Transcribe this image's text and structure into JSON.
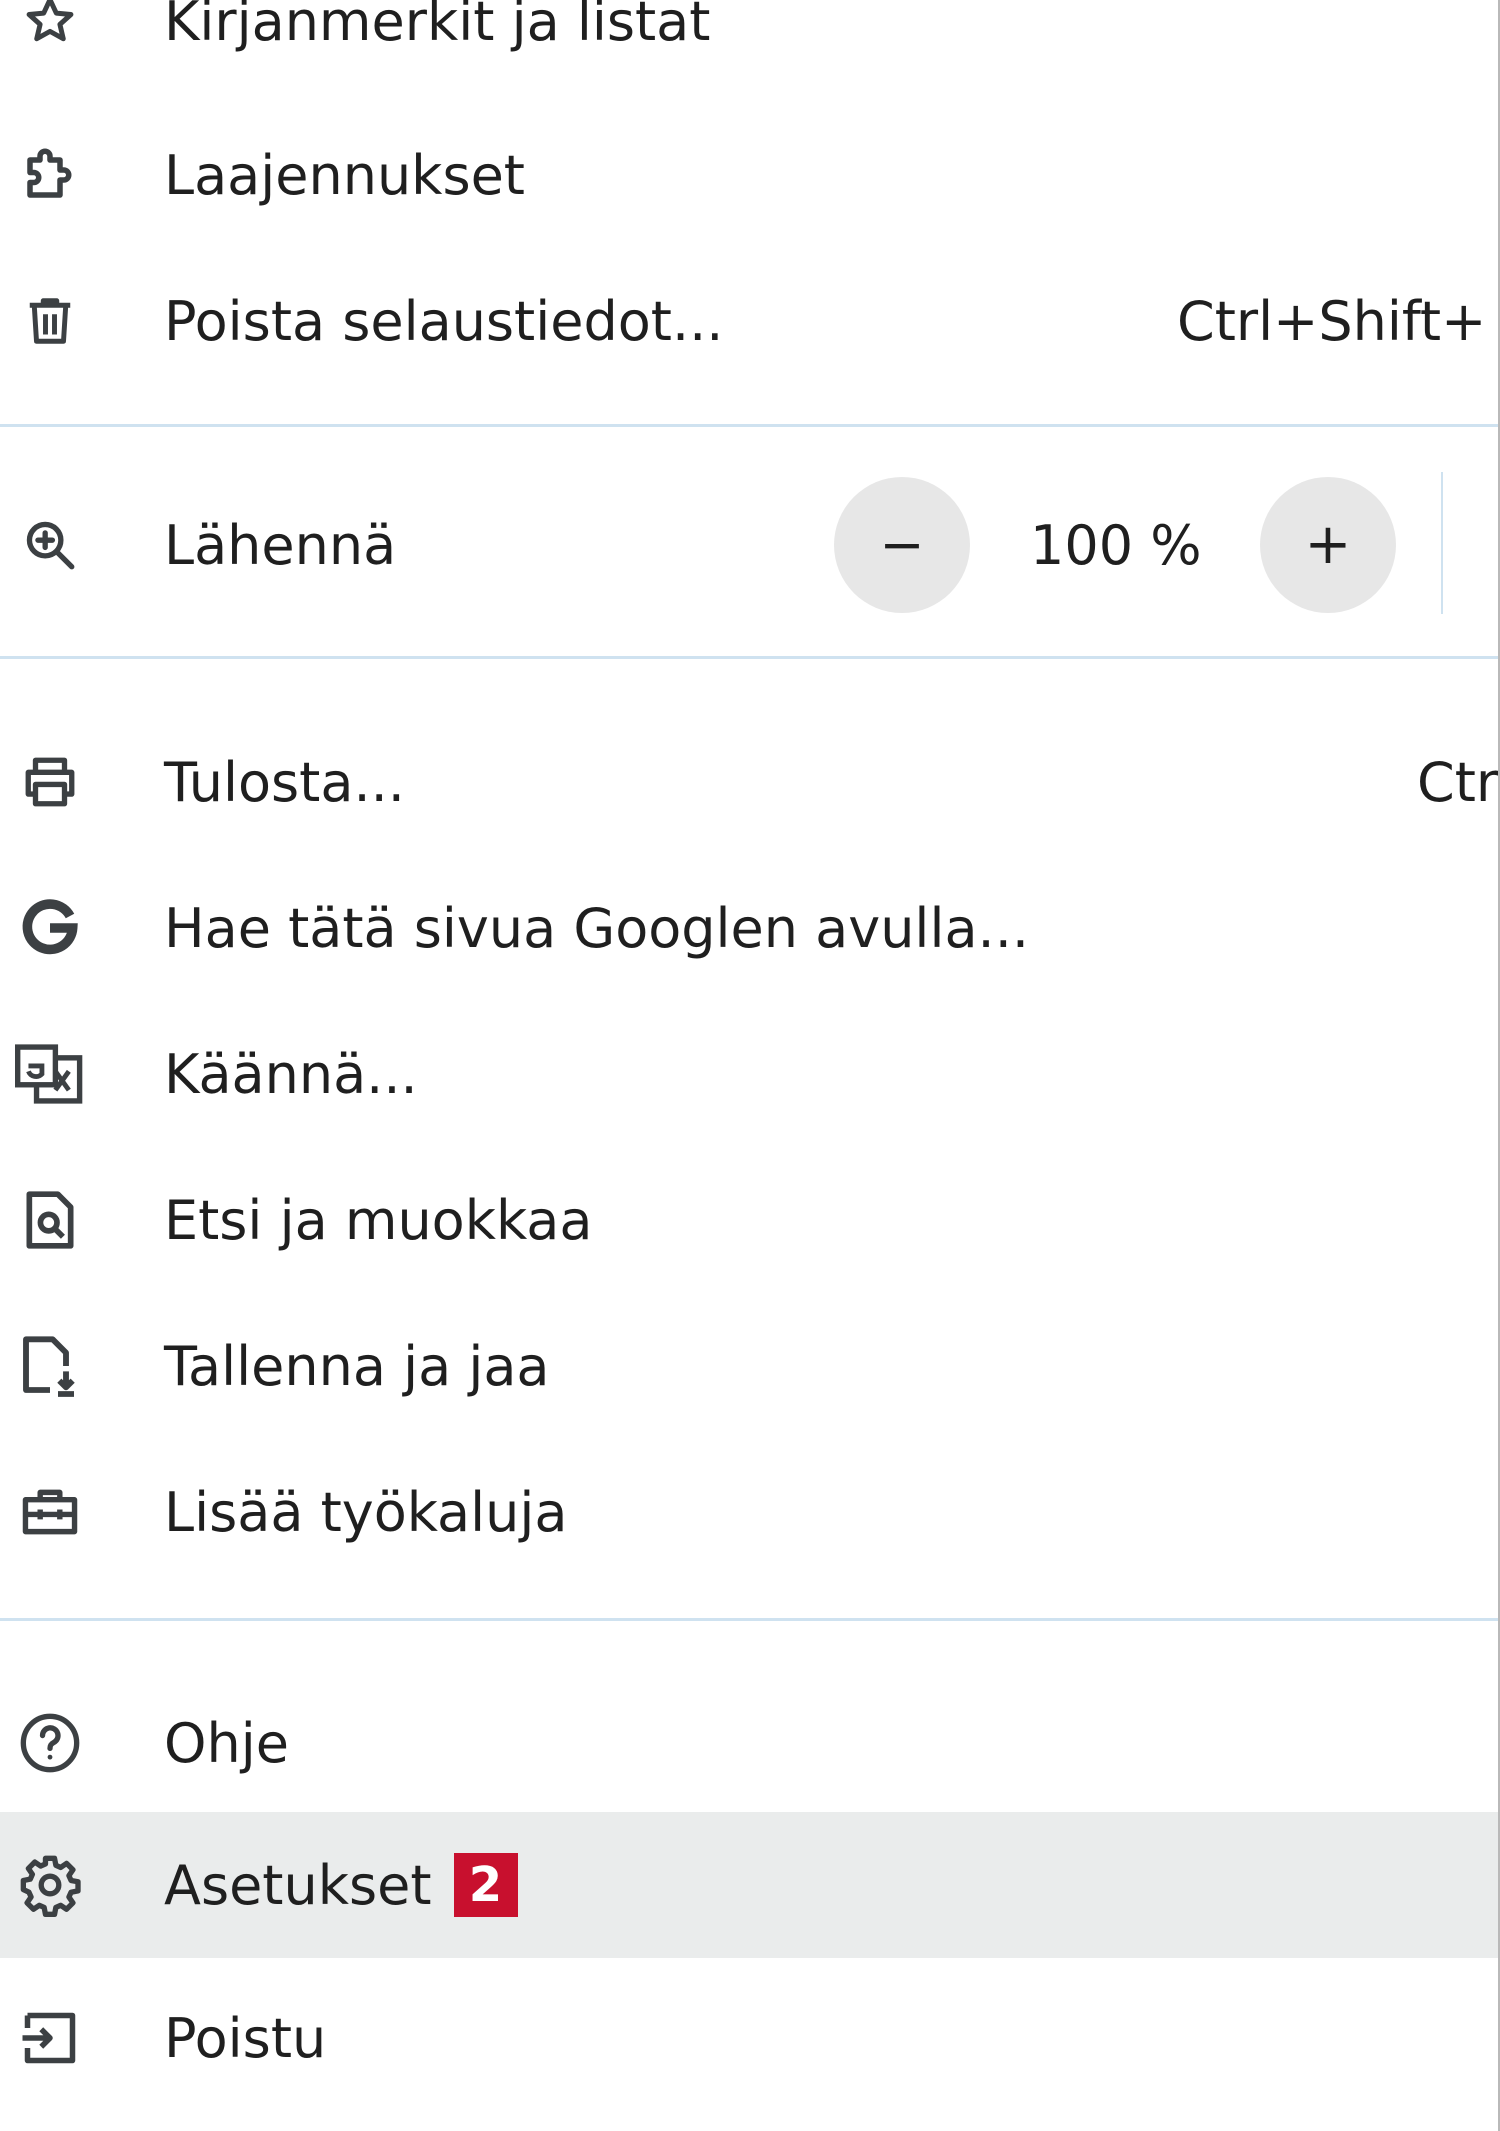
{
  "menu": {
    "bookmarks": {
      "label": "Kirjanmerkit ja listat",
      "icon": "star-icon"
    },
    "extensions": {
      "label": "Laajennukset",
      "icon": "puzzle-icon"
    },
    "clear_data": {
      "label": "Poista selaustiedot...",
      "shortcut": "Ctrl+Shift+",
      "icon": "trash-icon"
    },
    "zoom": {
      "label": "Lähennä",
      "value": "100 %",
      "minus_symbol": "−",
      "plus_symbol": "+",
      "icon": "zoom-in-icon"
    },
    "print": {
      "label": "Tulosta...",
      "shortcut": "Ctr",
      "icon": "printer-icon"
    },
    "google_search": {
      "label": "Hae tätä sivua Googlen avulla...",
      "icon": "google-icon"
    },
    "translate": {
      "label": "Käännä...",
      "icon": "translate-icon"
    },
    "find_edit": {
      "label": "Etsi ja muokkaa",
      "icon": "find-page-icon"
    },
    "save_share": {
      "label": "Tallenna ja jaa",
      "icon": "save-file-icon"
    },
    "more_tools": {
      "label": "Lisää työkaluja",
      "icon": "toolbox-icon"
    },
    "help": {
      "label": "Ohje",
      "icon": "help-icon"
    },
    "settings": {
      "label": "Asetukset",
      "badge": "2",
      "icon": "gear-icon"
    },
    "exit": {
      "label": "Poistu",
      "icon": "exit-icon"
    }
  },
  "colors": {
    "separator": "#cfe2f0",
    "highlight": "#eaecec",
    "badge": "#c8102e",
    "icon": "#3c4043"
  }
}
